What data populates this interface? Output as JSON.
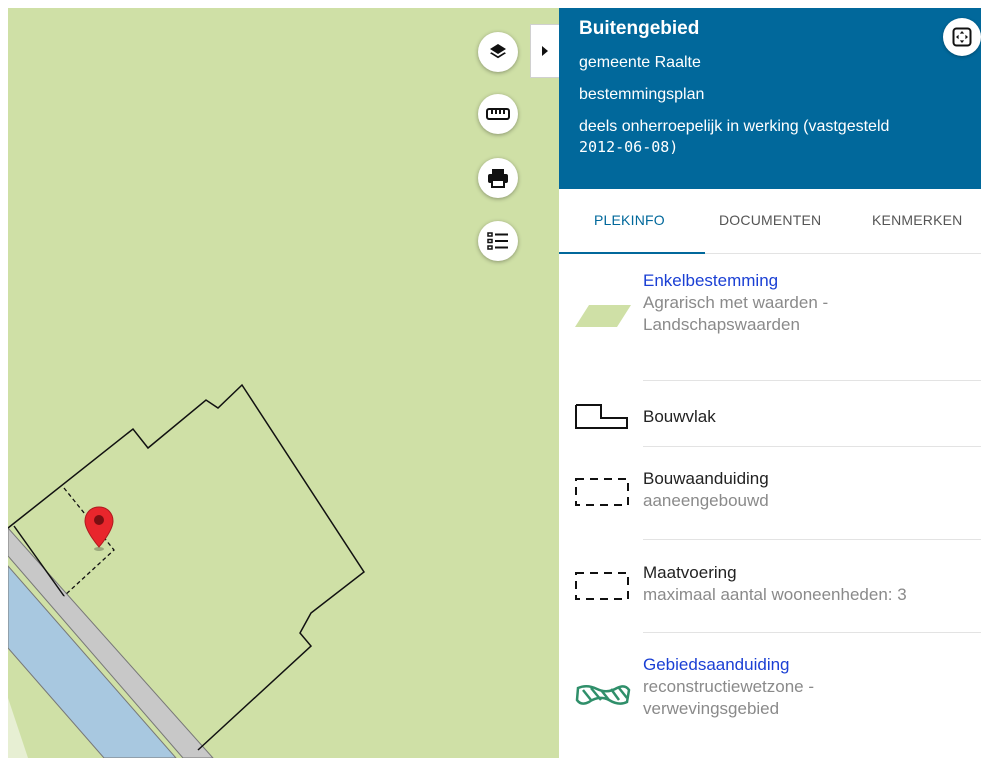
{
  "header": {
    "plan_name": "Buitengebied",
    "municipality": "gemeente Raalte",
    "plan_type": "bestemmingsplan",
    "status_text": "deels onherroepelijk in werking (vastgesteld",
    "status_date": "2012-06-08)"
  },
  "tabs": [
    {
      "label": "PLEKINFO",
      "active": true
    },
    {
      "label": "DOCUMENTEN",
      "active": false
    },
    {
      "label": "KENMERKEN",
      "active": false
    }
  ],
  "items": [
    {
      "title": "Enkelbestemming",
      "subtitle": "Agrarisch met waarden -",
      "subtitle2": "Landschapswaarden",
      "icon": "parallelogram-green-icon",
      "link": true
    },
    {
      "title": "Bouwvlak",
      "icon": "building-plot-outline-icon",
      "link": false
    },
    {
      "title": "Bouwaanduiding",
      "subtitle": "aaneengebouwd",
      "icon": "dashed-rectangle-icon",
      "link": false
    },
    {
      "title": "Maatvoering",
      "subtitle": "maximaal aantal wooneenheden: 3",
      "icon": "dashed-rectangle-icon",
      "link": false
    },
    {
      "title": "Gebiedsaanduiding",
      "subtitle": "reconstructiewetzone -",
      "subtitle2": "verwevingsgebied",
      "icon": "green-hatched-area-icon",
      "link": true
    }
  ],
  "map_tools": [
    "layers-icon",
    "ruler-icon",
    "printer-icon",
    "legend-list-icon"
  ],
  "colors": {
    "header_bg": "#01689b",
    "map_bg": "#cfe0a6",
    "link": "#1a3fd4",
    "water": "#a8c8e0",
    "road": "#c8c8c8",
    "marker": "#e8262c"
  }
}
